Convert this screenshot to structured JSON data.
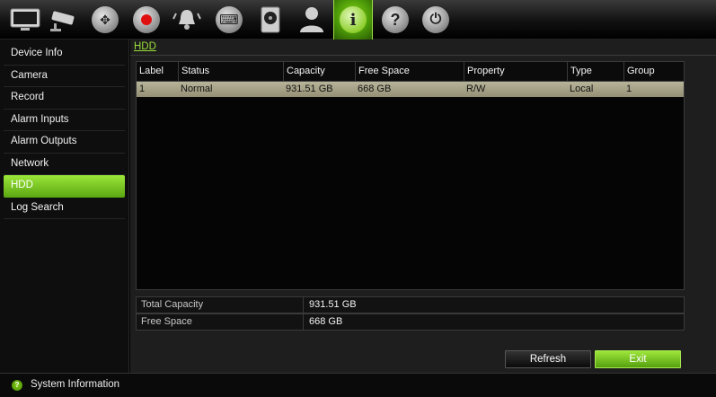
{
  "toolbar": {
    "icons": [
      {
        "name": "monitor-icon",
        "glyph": "▭"
      },
      {
        "name": "camera-icon",
        "glyph": "◧"
      },
      {
        "name": "ptz-icon",
        "glyph": "✥"
      },
      {
        "name": "record-icon",
        "glyph": "●"
      },
      {
        "name": "alarm-icon",
        "glyph": "🔔"
      },
      {
        "name": "keyboard-icon",
        "glyph": "⌨"
      },
      {
        "name": "hdd-icon",
        "glyph": "▣"
      },
      {
        "name": "user-icon",
        "glyph": "👤"
      },
      {
        "name": "info-icon",
        "glyph": "i"
      },
      {
        "name": "help-icon",
        "glyph": "?"
      },
      {
        "name": "power-icon",
        "glyph": "⏻"
      }
    ]
  },
  "sidebar": {
    "items": [
      {
        "label": "Device Info"
      },
      {
        "label": "Camera"
      },
      {
        "label": "Record"
      },
      {
        "label": "Alarm Inputs"
      },
      {
        "label": "Alarm Outputs"
      },
      {
        "label": "Network"
      },
      {
        "label": "HDD"
      },
      {
        "label": "Log Search"
      }
    ],
    "active_index": 6
  },
  "main": {
    "tab": "HDD",
    "table": {
      "columns": [
        "Label",
        "Status",
        "Capacity",
        "Free Space",
        "Property",
        "Type",
        "Group"
      ],
      "rows": [
        [
          "1",
          "Normal",
          "931.51 GB",
          "668 GB",
          "R/W",
          "Local",
          "1"
        ]
      ]
    },
    "summary": {
      "total_capacity_label": "Total Capacity",
      "total_capacity_value": "931.51 GB",
      "free_space_label": "Free Space",
      "free_space_value": "668 GB"
    },
    "buttons": {
      "refresh": "Refresh",
      "exit": "Exit"
    }
  },
  "statusbar": {
    "text": "System Information"
  },
  "colors": {
    "accent": "#6fc41a",
    "selected_row": "#a6a288"
  }
}
